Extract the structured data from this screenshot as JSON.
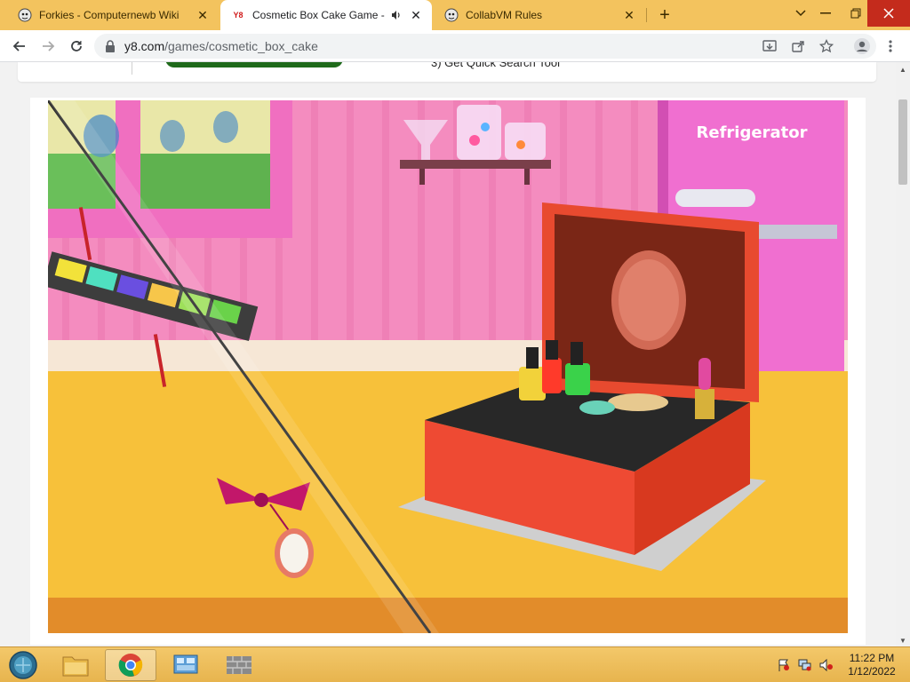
{
  "tabs": [
    {
      "title": "Forkies - Computernewb Wiki",
      "favicon": "wiki-favicon-icon"
    },
    {
      "title": "Cosmetic Box Cake Game - P",
      "favicon": "y8-favicon-icon",
      "badge": "Y8",
      "audio": "speaker-icon"
    },
    {
      "title": "CollabVM Rules",
      "favicon": "collabvm-favicon-icon"
    }
  ],
  "address": {
    "host": "y8.com",
    "path": "/games/cosmetic_box_cake"
  },
  "page": {
    "promo_text": "3)  Get Quick Search Tool"
  },
  "game": {
    "refrigerator_label": "Refrigerator"
  },
  "clock": {
    "time": "11:22 PM",
    "date": "1/12/2022"
  },
  "colors": {
    "tabstrip": "#f3c35e",
    "wall_pink": "#f48cbf",
    "counter": "#f7c13a",
    "box_red": "#ef4a30"
  }
}
